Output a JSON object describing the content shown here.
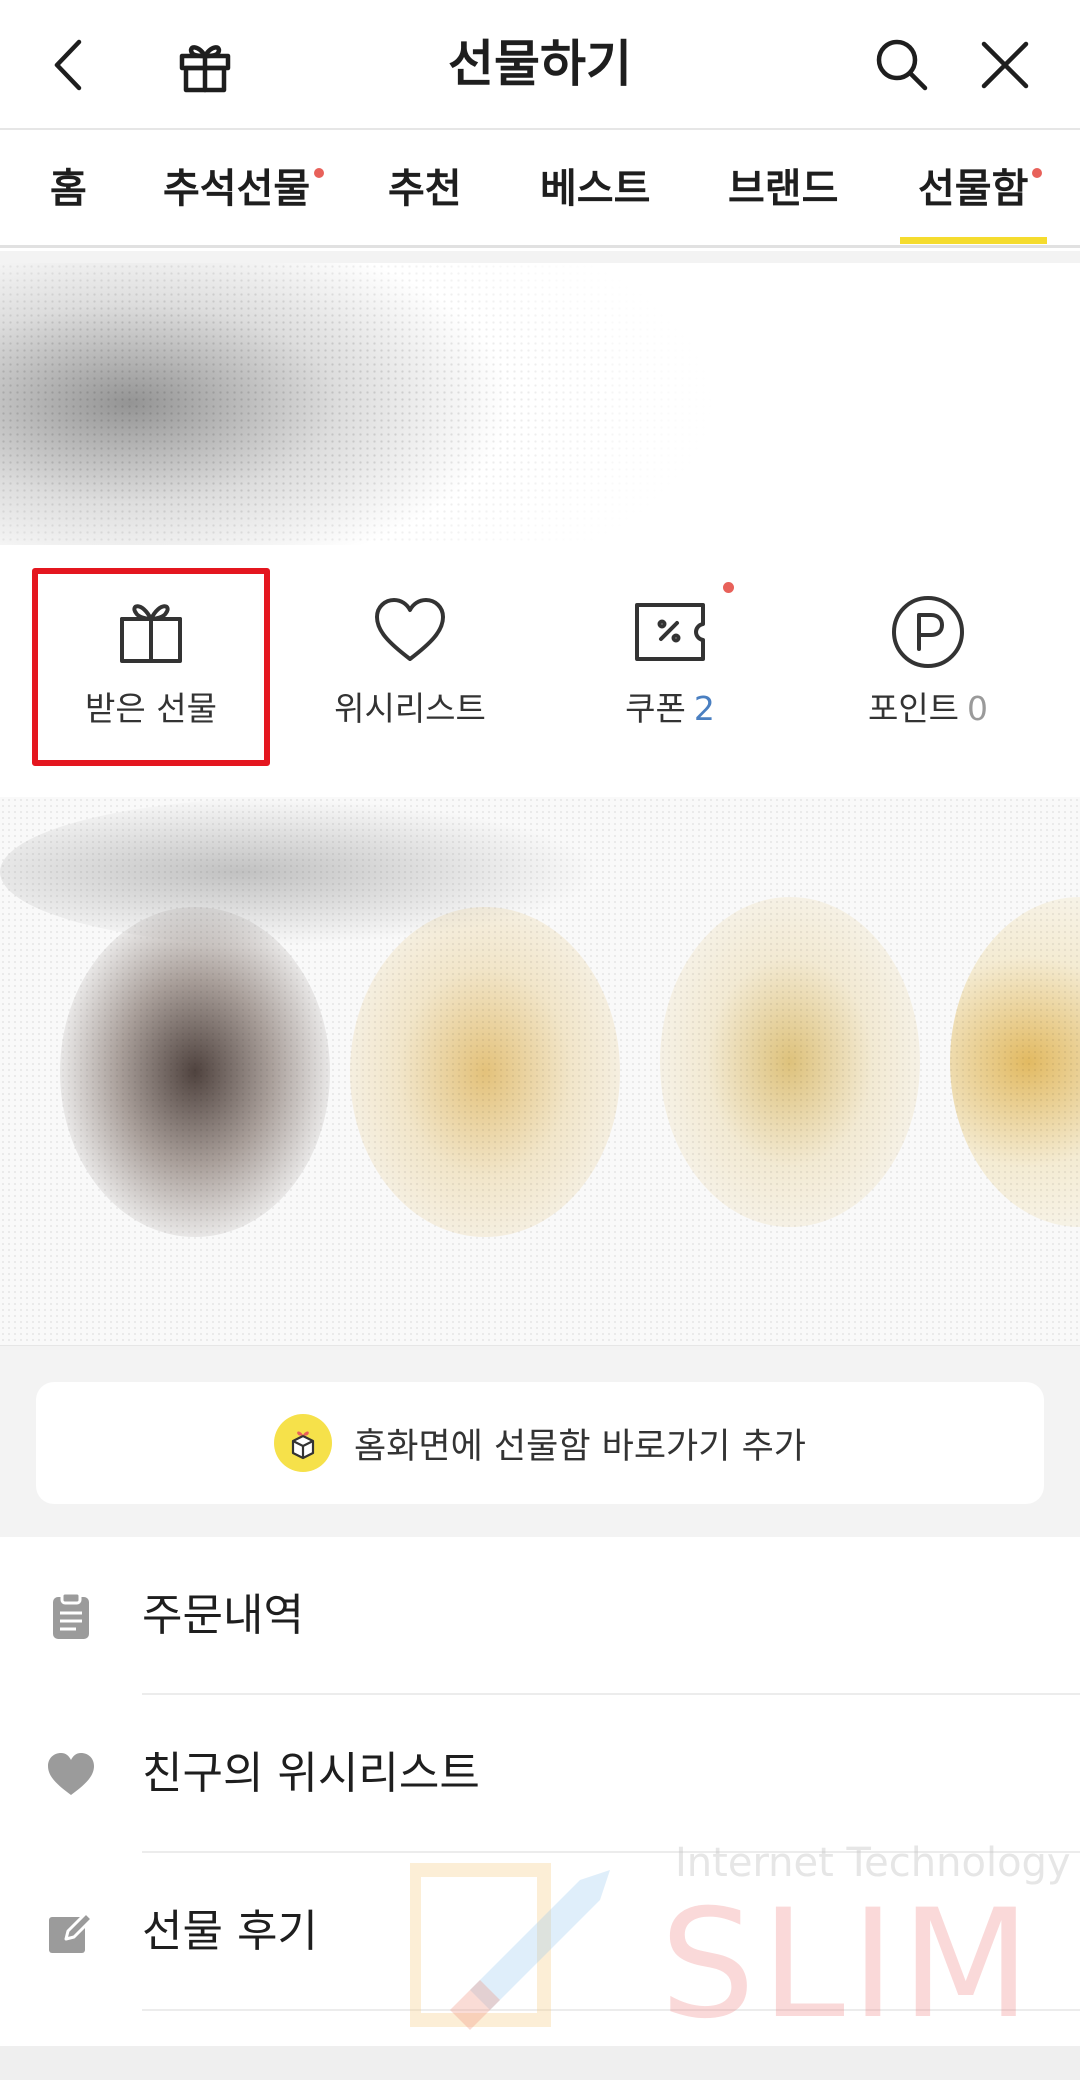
{
  "header": {
    "title": "선물하기",
    "back_icon": "back-arrow-icon",
    "gift_icon": "gift-icon",
    "search_icon": "search-icon",
    "close_icon": "close-icon"
  },
  "tabs": [
    {
      "label": "홈",
      "dot": false,
      "active": false
    },
    {
      "label": "추석선물",
      "dot": true,
      "active": false
    },
    {
      "label": "추천",
      "dot": false,
      "active": false
    },
    {
      "label": "베스트",
      "dot": false,
      "active": false
    },
    {
      "label": "브랜드",
      "dot": false,
      "active": false
    },
    {
      "label": "선물함",
      "dot": true,
      "active": true
    }
  ],
  "accent_color": "#f5dc2e",
  "notification_dot_color": "#e8615a",
  "highlight_color": "#e4161f",
  "quick_menu": [
    {
      "label": "받은 선물",
      "icon": "gift-box-icon",
      "count": null,
      "highlighted": true
    },
    {
      "label": "위시리스트",
      "icon": "heart-icon",
      "count": null
    },
    {
      "label": "쿠폰",
      "icon": "coupon-icon",
      "count": "2",
      "dot": true
    },
    {
      "label": "포인트",
      "icon": "point-icon",
      "count": "0"
    }
  ],
  "shortcut": {
    "label": "홈화면에 선물함 바로가기 추가",
    "icon": "gift-shortcut-icon"
  },
  "list": [
    {
      "label": "주문내역",
      "icon": "clipboard-icon"
    },
    {
      "label": "친구의 위시리스트",
      "icon": "heart-filled-icon"
    },
    {
      "label": "선물 후기",
      "icon": "edit-icon"
    }
  ],
  "watermark": {
    "top": "Internet Technology",
    "big": "SLIM"
  }
}
